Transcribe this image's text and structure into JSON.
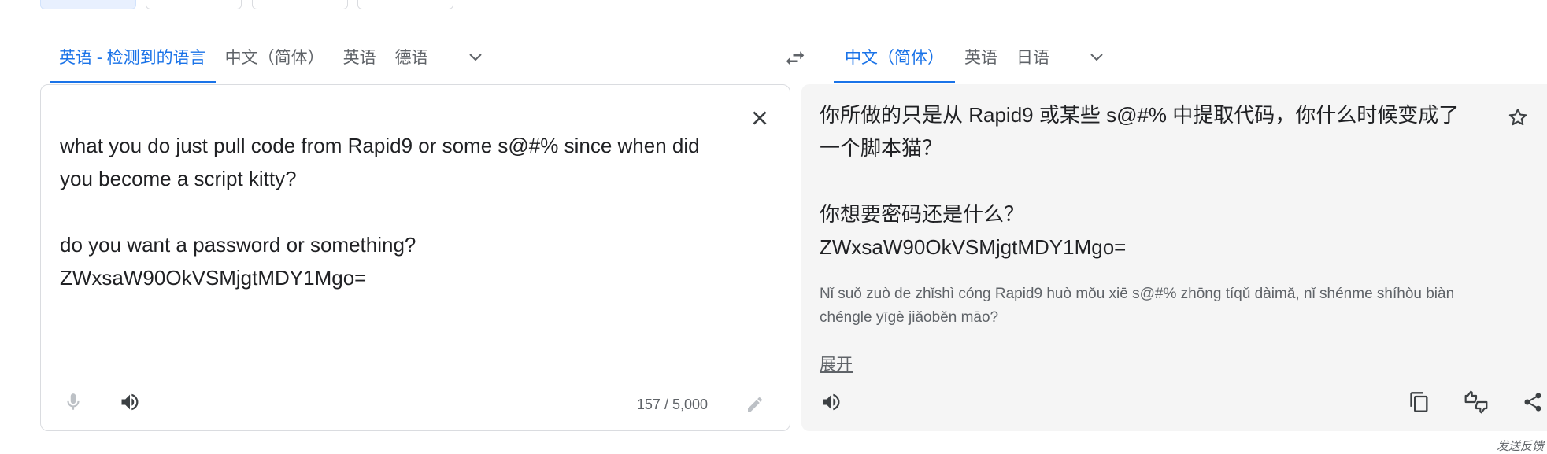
{
  "source_tabs": {
    "detected": "英语 - 检测到的语言",
    "items": [
      "中文（简体）",
      "英语",
      "德语"
    ]
  },
  "target_tabs": {
    "active": "中文（简体）",
    "items": [
      "英语",
      "日语"
    ]
  },
  "source": {
    "text": "what you do just pull code from Rapid9 or some s@#% since when did\nyou become a script kitty?\n\ndo you want a password or something?\nZWxsaW90OkVSMjgtMDY1Mgo=",
    "char_count": "157 / 5,000"
  },
  "target": {
    "text": "你所做的只是从 Rapid9 或某些 s@#% 中提取代码，你什么时候变成了\n一个脚本猫？\n\n你想要密码还是什么？\nZWxsaW90OkVSMjgtMDY1Mgo=",
    "romanization": "Nǐ suǒ zuò de zhǐshì cóng Rapid9 huò mǒu xiē s@#% zhōng tíqǔ dàimǎ, nǐ shénme shíhòu biàn chéngle yīgè jiǎoběn māo?",
    "expand_label": "展开"
  },
  "footer": {
    "feedback_label": "发送反馈"
  },
  "icons": [
    "chevron-down-icon",
    "swap-icon",
    "close-icon",
    "microphone-icon",
    "speaker-icon",
    "pencil-icon",
    "star-icon",
    "copy-icon",
    "rate-icon",
    "share-icon"
  ],
  "colors": {
    "accent": "#1a73e8",
    "muted": "#5f6368",
    "target_bg": "#f5f5f5"
  }
}
